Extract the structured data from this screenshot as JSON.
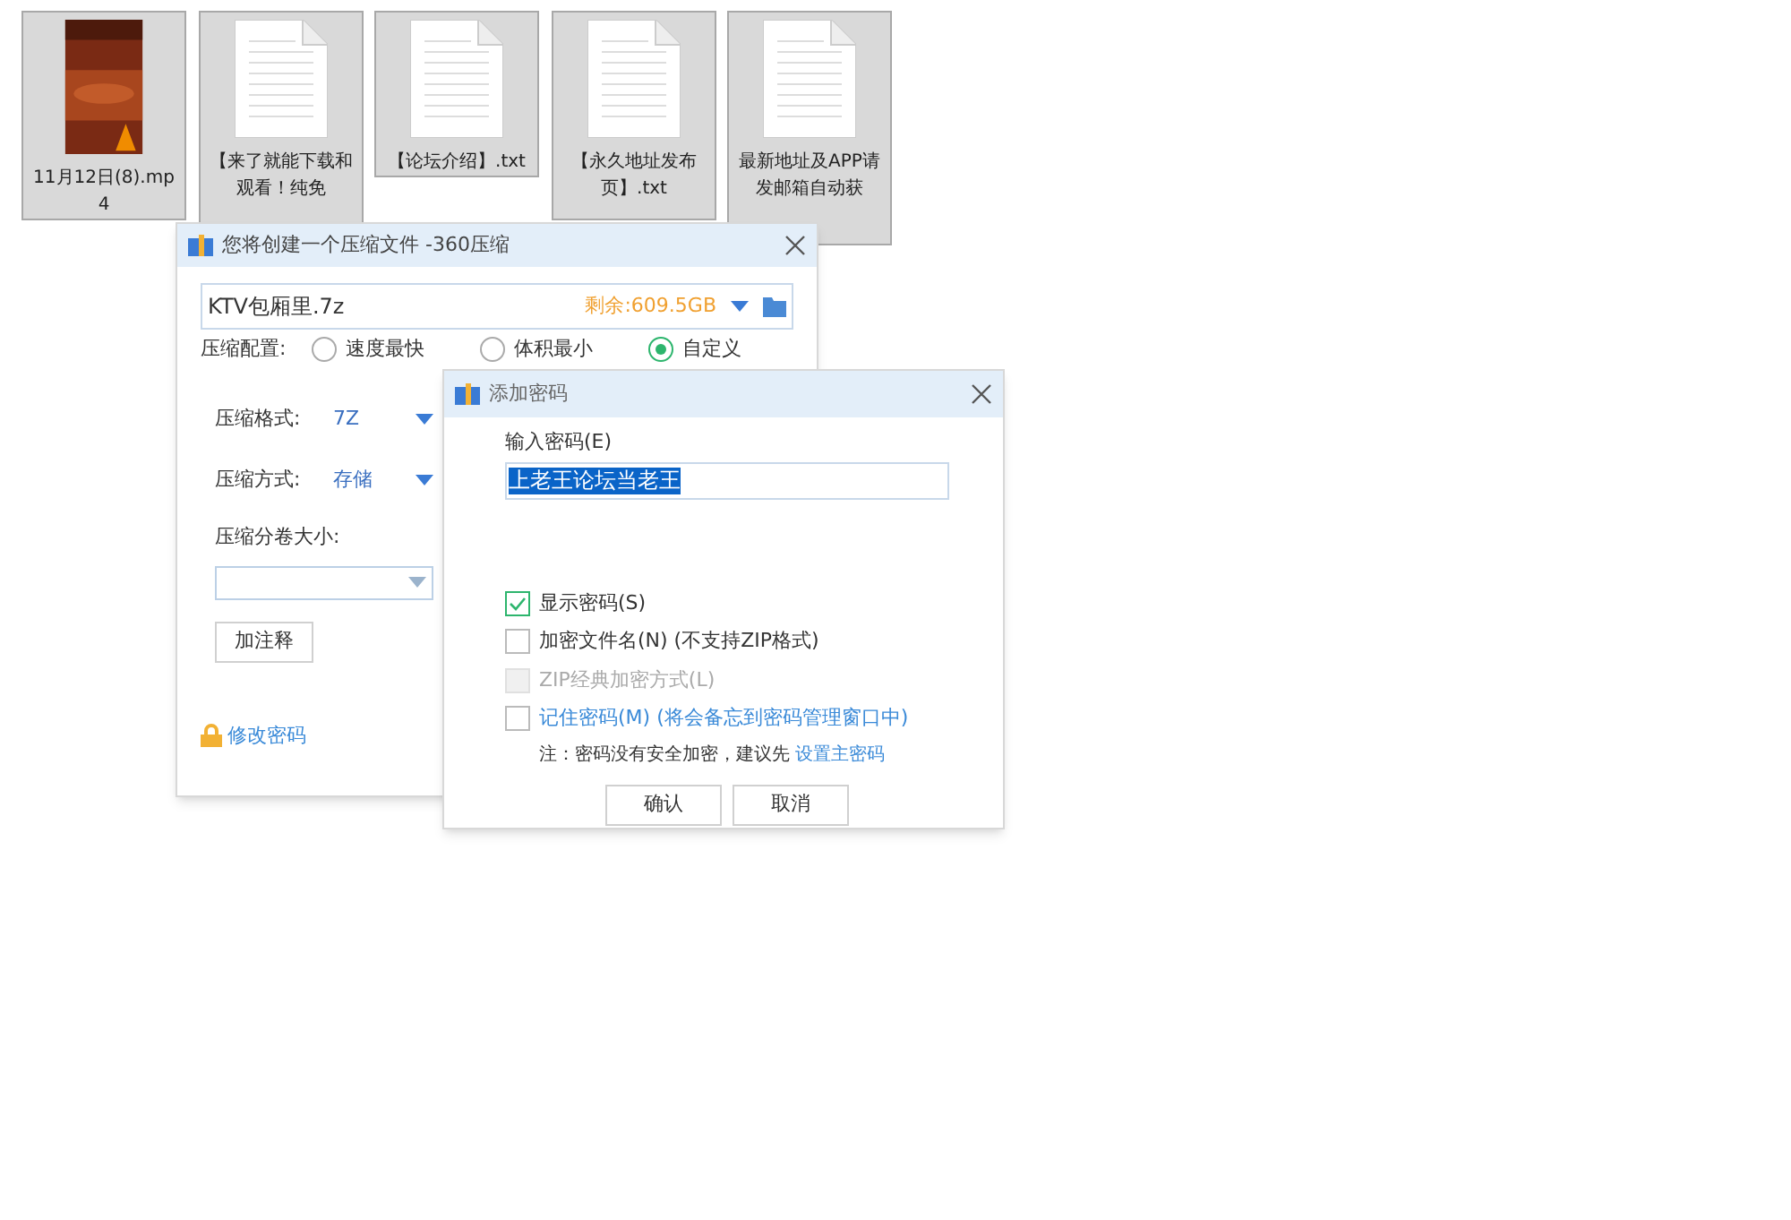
{
  "files": [
    {
      "kind": "video",
      "label": "11月12日(8).mp4"
    },
    {
      "kind": "text",
      "label": "【来了就能下载和观看！纯免"
    },
    {
      "kind": "text",
      "label": "【论坛介绍】.txt"
    },
    {
      "kind": "text",
      "label": "【永久地址发布页】.txt"
    },
    {
      "kind": "text",
      "label": "最新地址及APP请发邮箱自动获"
    }
  ],
  "compress_dialog": {
    "title": "您将创建一个压缩文件 -360压缩",
    "filename": "KTV包厢里.7z",
    "free_space": "剩余:609.5GB",
    "config_label": "压缩配置:",
    "presets": [
      {
        "label": "速度最快",
        "selected": false
      },
      {
        "label": "体积最小",
        "selected": false
      },
      {
        "label": "自定义",
        "selected": true
      }
    ],
    "format_label": "压缩格式:",
    "format": "7Z",
    "method_label": "压缩方式:",
    "method": "存储",
    "volume_label": "压缩分卷大小:",
    "comment_button": "加注释",
    "change_password": "修改密码"
  },
  "password_dialog": {
    "title": "添加密码",
    "input_label": "输入密码(E)",
    "password": "上老王论坛当老王",
    "options": [
      {
        "label": "显示密码(S)",
        "checked": true,
        "disabled": false,
        "link": false
      },
      {
        "label": "加密文件名(N) (不支持ZIP格式)",
        "checked": false,
        "disabled": false,
        "link": false
      },
      {
        "label": "ZIP经典加密方式(L)",
        "checked": false,
        "disabled": true,
        "link": false
      },
      {
        "label": "记住密码(M) (将会备忘到密码管理窗口中)",
        "checked": false,
        "disabled": false,
        "link": true
      }
    ],
    "note": "注：密码没有安全加密，建议先",
    "note_link": "设置主密码",
    "buttons": [
      "确认",
      "取消"
    ]
  }
}
